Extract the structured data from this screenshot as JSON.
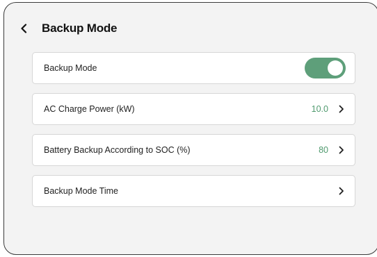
{
  "header": {
    "title": "Backup Mode",
    "back_icon": "chevron-left-icon"
  },
  "settings": {
    "backup_mode": {
      "label": "Backup Mode",
      "toggle_on": true,
      "toggle_color": "#5e9f7a"
    },
    "ac_charge_power": {
      "label": "AC Charge Power (kW)",
      "value": "10.0"
    },
    "battery_backup_soc": {
      "label": "Battery Backup According to SOC (%)",
      "value": "80"
    },
    "backup_mode_time": {
      "label": "Backup Mode Time"
    }
  },
  "colors": {
    "accent_value": "#4f9a6e",
    "background": "#f3f3f3"
  }
}
